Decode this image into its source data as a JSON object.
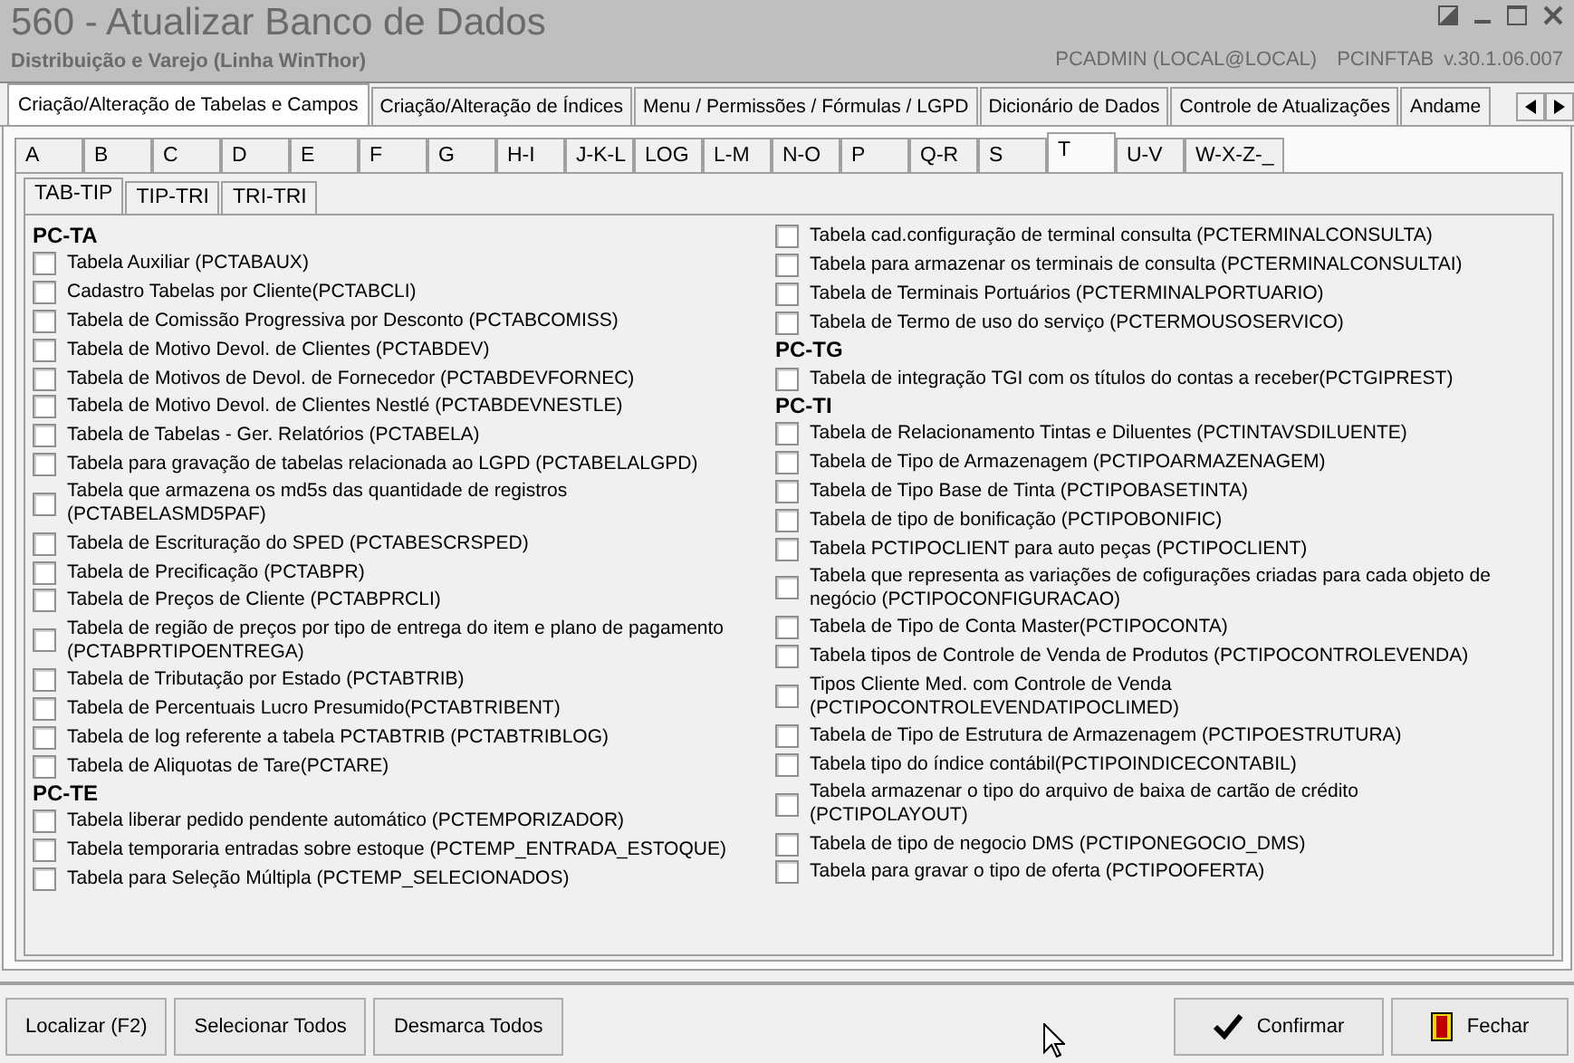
{
  "window": {
    "title": "560 - Atualizar Banco de Dados",
    "subtitle": "Distribuição e Varejo (Linha WinThor)",
    "user": "PCADMIN (LOCAL@LOCAL)",
    "module": "PCINFTAB",
    "version": "v.30.1.06.007"
  },
  "main_tabs": [
    {
      "label": "Criação/Alteração de Tabelas e Campos",
      "selected": true
    },
    {
      "label": "Criação/Alteração de Índices",
      "selected": false
    },
    {
      "label": "Menu / Permissões / Fórmulas / LGPD",
      "selected": false
    },
    {
      "label": "Dicionário de Dados",
      "selected": false
    },
    {
      "label": "Controle de Atualizações",
      "selected": false
    },
    {
      "label": "Andame",
      "selected": false
    }
  ],
  "letter_tabs": [
    {
      "label": "A",
      "selected": false
    },
    {
      "label": "B",
      "selected": false
    },
    {
      "label": "C",
      "selected": false
    },
    {
      "label": "D",
      "selected": false
    },
    {
      "label": "E",
      "selected": false
    },
    {
      "label": "F",
      "selected": false
    },
    {
      "label": "G",
      "selected": false
    },
    {
      "label": "H-I",
      "selected": false
    },
    {
      "label": "J-K-L",
      "selected": false
    },
    {
      "label": "LOG",
      "selected": false
    },
    {
      "label": "L-M",
      "selected": false
    },
    {
      "label": "N-O",
      "selected": false
    },
    {
      "label": "P",
      "selected": false
    },
    {
      "label": "Q-R",
      "selected": false
    },
    {
      "label": "S",
      "selected": false
    },
    {
      "label": "T",
      "selected": true
    },
    {
      "label": "U-V",
      "selected": false
    },
    {
      "label": "W-X-Z-_",
      "selected": false
    }
  ],
  "sub_tabs": [
    {
      "label": "TAB-TIP",
      "selected": true
    },
    {
      "label": "TIP-TRI",
      "selected": false
    },
    {
      "label": "TRI-TRI",
      "selected": false
    }
  ],
  "columns": [
    [
      {
        "title": "PC-TA",
        "items": [
          {
            "label": "Tabela Auxiliar (PCTABAUX)",
            "checked": false
          },
          {
            "label": "Cadastro Tabelas por Cliente(PCTABCLI)",
            "checked": false
          },
          {
            "label": "Tabela de Comissão Progressiva por Desconto (PCTABCOMISS)",
            "checked": false
          },
          {
            "label": "Tabela de Motivo  Devol. de Clientes (PCTABDEV)",
            "checked": false
          },
          {
            "label": "Tabela de Motivos de Devol. de Fornecedor (PCTABDEVFORNEC)",
            "checked": false
          },
          {
            "label": "Tabela de Motivo  Devol. de Clientes Nestlé (PCTABDEVNESTLE)",
            "checked": false
          },
          {
            "label": "Tabela de Tabelas - Ger. Relatórios (PCTABELA)",
            "checked": false
          },
          {
            "label": "Tabela para gravação de tabelas relacionada ao LGPD (PCTABELALGPD)",
            "checked": false
          },
          {
            "label": "Tabela que armazena os md5s das quantidade de registros (PCTABELASMD5PAF)",
            "checked": false
          },
          {
            "label": "Tabela de Escrituração do SPED (PCTABESCRSPED)",
            "checked": false
          },
          {
            "label": "Tabela de Precificação (PCTABPR)",
            "checked": false
          },
          {
            "label": "Tabela de Preços de Cliente (PCTABPRCLI)",
            "checked": false
          },
          {
            "label": "Tabela de região de preços por tipo de entrega do item e plano de pagamento (PCTABPRTIPOENTREGA)",
            "checked": false
          },
          {
            "label": "Tabela de Tributação por Estado (PCTABTRIB)",
            "checked": false
          },
          {
            "label": "Tabela de Percentuais Lucro Presumido(PCTABTRIBENT)",
            "checked": false
          },
          {
            "label": "Tabela de log referente a tabela PCTABTRIB (PCTABTRIBLOG)",
            "checked": false
          },
          {
            "label": "Tabela de Aliquotas de Tare(PCTARE)",
            "checked": false
          }
        ]
      },
      {
        "title": "PC-TE",
        "items": [
          {
            "label": "Tabela liberar pedido pendente automático (PCTEMPORIZADOR)",
            "checked": false
          },
          {
            "label": "Tabela temporaria entradas sobre estoque (PCTEMP_ENTRADA_ESTOQUE)",
            "checked": false
          },
          {
            "label": "Tabela para Seleção Múltipla (PCTEMP_SELECIONADOS)",
            "checked": false
          }
        ]
      }
    ],
    [
      {
        "items": [
          {
            "label": "Tabela cad.configuração de terminal consulta (PCTERMINALCONSULTA)",
            "checked": false
          },
          {
            "label": "Tabela para armazenar os terminais de consulta (PCTERMINALCONSULTAI)",
            "checked": false
          },
          {
            "label": "Tabela de Terminais Portuários (PCTERMINALPORTUARIO)",
            "checked": false
          },
          {
            "label": "Tabela de Termo de uso do serviço (PCTERMOUSOSERVICO)",
            "checked": false
          }
        ]
      },
      {
        "title": "PC-TG",
        "items": [
          {
            "label": "Tabela de integração TGI com os títulos do contas a receber(PCTGIPREST)",
            "checked": false
          }
        ]
      },
      {
        "title": "PC-TI",
        "items": [
          {
            "label": "Tabela de Relacionamento Tintas e Diluentes (PCTINTAVSDILUENTE)",
            "checked": false
          },
          {
            "label": "Tabela de Tipo de Armazenagem (PCTIPOARMAZENAGEM)",
            "checked": false
          },
          {
            "label": "Tabela de Tipo Base de Tinta (PCTIPOBASETINTA)",
            "checked": false
          },
          {
            "label": "Tabela de tipo de bonificação (PCTIPOBONIFIC)",
            "checked": false
          },
          {
            "label": "Tabela PCTIPOCLIENT  para auto peças (PCTIPOCLIENT)",
            "checked": false
          },
          {
            "label": "Tabela que representa as variações de cofigurações criadas para cada objeto de negócio (PCTIPOCONFIGURACAO)",
            "checked": false
          },
          {
            "label": "Tabela de Tipo de Conta Master(PCTIPOCONTA)",
            "checked": false
          },
          {
            "label": "Tabela tipos de Controle de Venda de Produtos (PCTIPOCONTROLEVENDA)",
            "checked": false
          },
          {
            "label": "Tipos Cliente Med. com Controle de Venda (PCTIPOCONTROLEVENDATIPOCLIMED)",
            "checked": false
          },
          {
            "label": "Tabela de Tipo de Estrutura de Armazenagem (PCTIPOESTRUTURA)",
            "checked": false
          },
          {
            "label": "Tabela tipo do índice contábil(PCTIPOINDICECONTABIL)",
            "checked": false
          },
          {
            "label": "Tabela armazenar o tipo do arquivo de baixa de cartão de crédito (PCTIPOLAYOUT)",
            "checked": false
          },
          {
            "label": "Tabela de tipo de negocio DMS (PCTIPONEGOCIO_DMS)",
            "checked": false
          },
          {
            "label": "Tabela para gravar o tipo de oferta (PCTIPOOFERTA)",
            "checked": false
          }
        ]
      }
    ]
  ],
  "buttons": [
    {
      "label": "Localizar (F2)",
      "kind": "plain"
    },
    {
      "label": "Selecionar Todos",
      "kind": "plain"
    },
    {
      "label": "Desmarca Todos",
      "kind": "plain"
    },
    {
      "label": "Confirmar",
      "kind": "confirm"
    },
    {
      "label": "Fechar",
      "kind": "close"
    }
  ]
}
